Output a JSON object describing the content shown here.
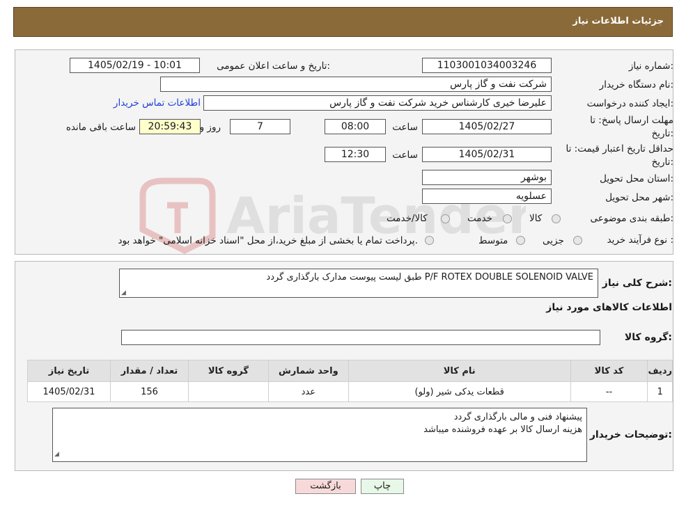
{
  "header": {
    "title": "جزئیات اطلاعات نیاز"
  },
  "form": {
    "need_number_label": "شماره نیاز:",
    "need_number": "1103001034003246",
    "announce_label": "تاریخ و ساعت اعلان عمومی:",
    "announce_value": "1405/02/19 - 10:01",
    "buyer_org_label": "نام دستگاه خریدار:",
    "buyer_org": "شرکت نفت و گاز پارس",
    "creator_label": "ایجاد کننده درخواست:",
    "creator": "علیرضا  خیری کارشناس خرید  شرکت نفت و گاز پارس",
    "contact_link": "اطلاعات تماس خریدار",
    "deadline_label_1": "مهلت ارسال پاسخ: تا",
    "deadline_label_2": "تاریخ:",
    "deadline_date": "1405/02/27",
    "time_label": "ساعت",
    "deadline_time": "08:00",
    "days_value": "7",
    "days_label": "روز و",
    "remaining_time": "20:59:43",
    "remaining_label": "ساعت باقی مانده",
    "validity_label_1": "حداقل تاریخ اعتبار قیمت: تا",
    "validity_label_2": "تاریخ:",
    "validity_date": "1405/02/31",
    "validity_time_label": "ساعت",
    "validity_time": "12:30",
    "province_label": "استان محل تحویل:",
    "province": "بوشهر",
    "city_label": "شهر محل تحویل:",
    "city": "عسلویه",
    "category_label": "طبقه بندی موضوعی:",
    "category_options": [
      "کالا",
      "خدمت",
      "کالا/خدمت"
    ],
    "process_label": "نوع فرآیند خرید :",
    "process_options": [
      "جزیی",
      "متوسط"
    ],
    "process_note": "پرداخت تمام یا بخشی از مبلغ خرید،از محل \"اسناد خزانه اسلامی\" خواهد بود."
  },
  "details": {
    "summary_label": "شرح کلی نیاز:",
    "summary": "P/F ROTEX DOUBLE SOLENOID VALVE طبق لیست پیوست مدارک بارگذاری گردد",
    "goods_info_title": "اطلاعات کالاهای مورد نیاز",
    "goods_group_label": "گروه کالا:",
    "goods_group_value": ""
  },
  "table": {
    "headers": [
      "ردیف",
      "کد کالا",
      "نام کالا",
      "واحد شمارش",
      "گروه کالا",
      "تعداد / مقدار",
      "تاریخ نیاز"
    ],
    "rows": [
      [
        "1",
        "--",
        "قطعات یدکی شیر (ولو)",
        "عدد",
        "",
        "156",
        "1405/02/31"
      ]
    ]
  },
  "buyer_notes": {
    "label": "توضیحات خریدار:",
    "line1": "پیشنهاد فنی و مالی بارگذاری گردد",
    "line2": "هزینه ارسال کالا بر عهده فروشنده میباشد"
  },
  "buttons": {
    "print": "چاپ",
    "back": "بازگشت"
  },
  "watermark": {
    "text": "AriaTender.neT"
  },
  "colors": {
    "header_bg": "#8b6a3a",
    "link": "#1e3fd8",
    "yellow_box": "#ffffcc",
    "back_button": "#f8d9d9"
  }
}
